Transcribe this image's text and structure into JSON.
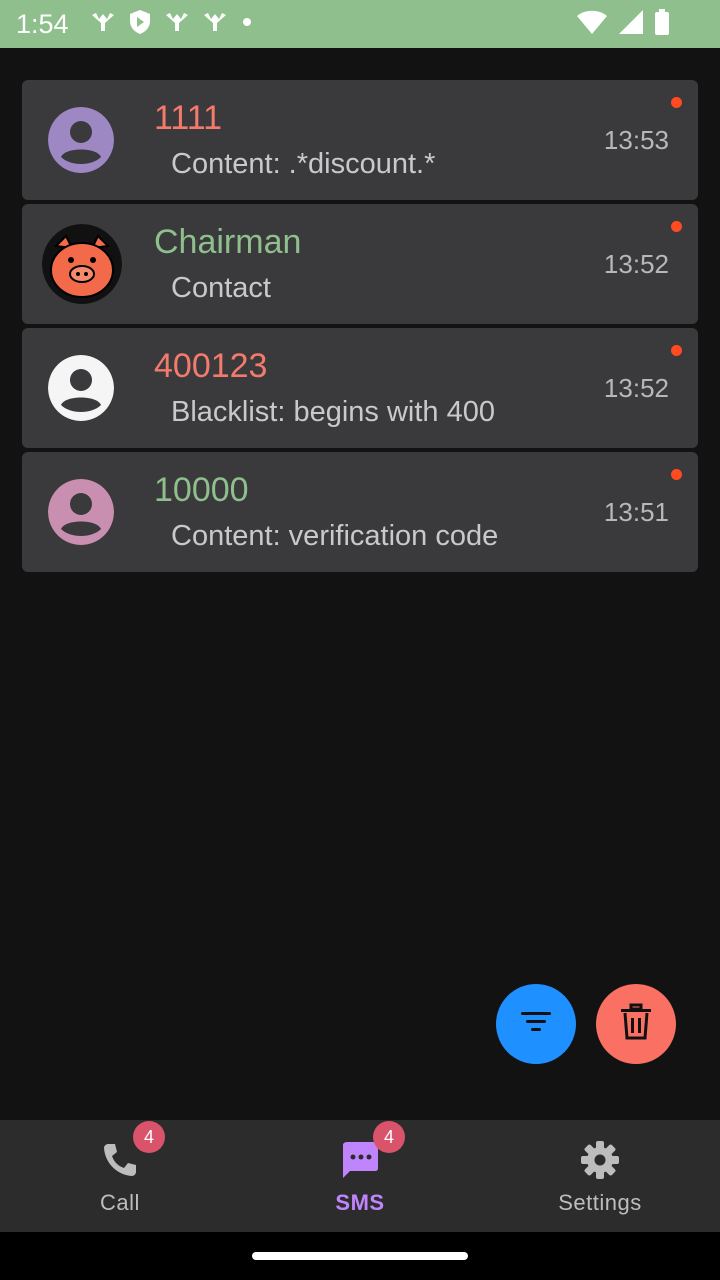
{
  "status_bar": {
    "time": "1:54",
    "background": "#8fbf8c",
    "left_icons": [
      "wifi-calling-icon",
      "shield-icon",
      "wifi-calling-icon",
      "wifi-calling-icon",
      "dot-icon"
    ],
    "right_icons": [
      "wifi-icon",
      "signal-icon",
      "battery-icon"
    ]
  },
  "messages": [
    {
      "title": "1111",
      "title_color": "#f47b6c",
      "subtitle": "Content: .*discount.*",
      "time": "13:53",
      "avatar": "person-icon",
      "avatar_color": "#9d88c4",
      "unread": true
    },
    {
      "title": "Chairman",
      "title_color": "#8fbf8c",
      "subtitle": "Contact",
      "time": "13:52",
      "avatar": "pig-avatar",
      "unread": true
    },
    {
      "title": "400123",
      "title_color": "#f47b6c",
      "subtitle": "Blacklist: begins with 400",
      "time": "13:52",
      "avatar": "person-icon",
      "avatar_color": "#f5f5f5",
      "unread": true
    },
    {
      "title": "10000",
      "title_color": "#8fbf8c",
      "subtitle": "Content: verification code",
      "time": "13:51",
      "avatar": "person-icon",
      "avatar_color": "#c98fb1",
      "unread": true
    }
  ],
  "fabs": {
    "filter": {
      "icon": "filter-icon",
      "color": "#1e90ff"
    },
    "delete": {
      "icon": "trash-icon",
      "color": "#fa7163"
    }
  },
  "bottom_nav": {
    "items": [
      {
        "label": "Call",
        "icon": "phone-icon",
        "badge": "4",
        "active": false
      },
      {
        "label": "SMS",
        "icon": "sms-icon",
        "badge": "4",
        "active": true
      },
      {
        "label": "Settings",
        "icon": "gear-icon",
        "badge": "",
        "active": false
      }
    ]
  }
}
